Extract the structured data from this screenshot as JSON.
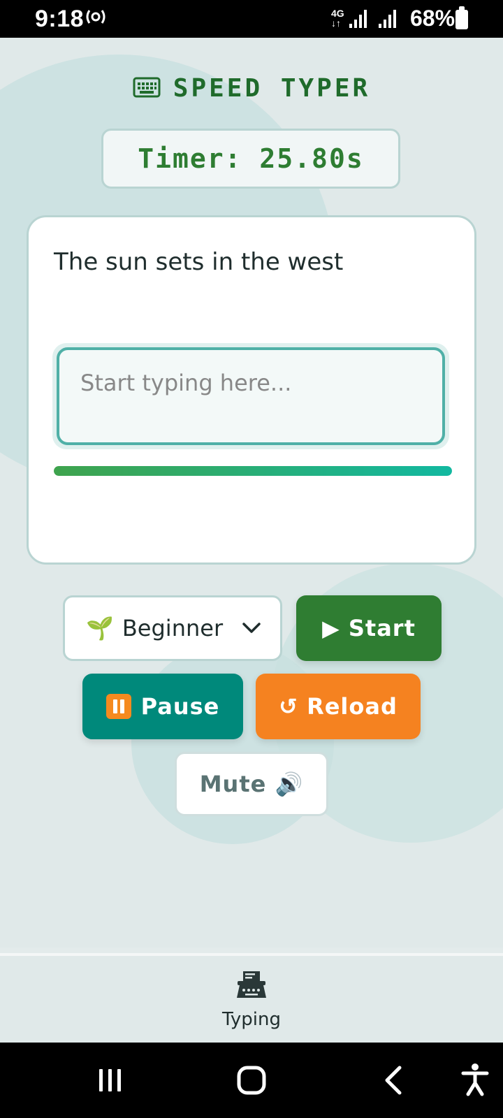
{
  "status_bar": {
    "time": "9:18",
    "hotspot_icon": "hotspot-icon",
    "network": "4G",
    "battery": "68%"
  },
  "app": {
    "title": "SPEED TYPER",
    "title_icon": "keyboard-icon",
    "timer_text": "Timer: 25.80s",
    "sentence": "The sun sets in the west",
    "input": {
      "value": "",
      "placeholder": "Start typing here..."
    },
    "progress": 1.0,
    "difficulty": {
      "icon": "🌱",
      "selected": "Beginner"
    },
    "buttons": {
      "start": "▶ Start",
      "pause": "Pause",
      "reload": "↺ Reload",
      "mute": "Mute 🔊"
    }
  },
  "bottom_nav": {
    "items": [
      {
        "label": "Typing",
        "icon": "typewriter-icon"
      }
    ]
  },
  "colors": {
    "title_green": "#1f6b2b",
    "start_green": "#2f7d32",
    "pause_teal": "#00897b",
    "reload_orange": "#f58220"
  }
}
